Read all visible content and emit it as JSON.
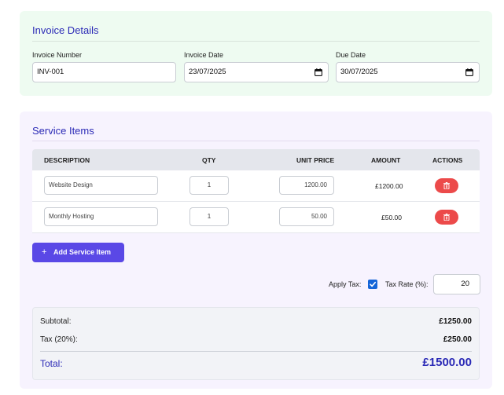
{
  "details": {
    "title": "Invoice Details",
    "invoice_number_label": "Invoice Number",
    "invoice_number": "INV-001",
    "invoice_date_label": "Invoice Date",
    "invoice_date": "23/07/2025",
    "due_date_label": "Due Date",
    "due_date": "30/07/2025"
  },
  "items": {
    "title": "Service Items",
    "headers": {
      "description": "DESCRIPTION",
      "qty": "QTY",
      "unit_price": "UNIT PRICE",
      "amount": "AMOUNT",
      "actions": "ACTIONS"
    },
    "rows": [
      {
        "description": "Website Design",
        "qty": "1",
        "unit_price": "1200.00",
        "amount": "£1200.00"
      },
      {
        "description": "Monthly Hosting",
        "qty": "1",
        "unit_price": "50.00",
        "amount": "£50.00"
      }
    ],
    "add_button": "Add Service Item",
    "add_icon": "+"
  },
  "tax": {
    "apply_label": "Apply Tax:",
    "apply_checked": true,
    "rate_label": "Tax Rate (%):",
    "rate_value": "20"
  },
  "summary": {
    "subtotal_label": "Subtotal:",
    "subtotal_value": "£1250.00",
    "tax_label": "Tax (20%):",
    "tax_value": "£250.00",
    "total_label": "Total:",
    "total_value": "£1500.00"
  },
  "colors": {
    "accent": "#2b2ab6",
    "primary_button": "#5a48e6",
    "delete_button": "#ec4a4a",
    "details_bg": "#eefbf1",
    "items_bg": "#f7f3fe"
  },
  "icons": {
    "calendar": "calendar-icon",
    "delete": "trash-icon",
    "add": "plus-icon",
    "check": "check-icon"
  }
}
